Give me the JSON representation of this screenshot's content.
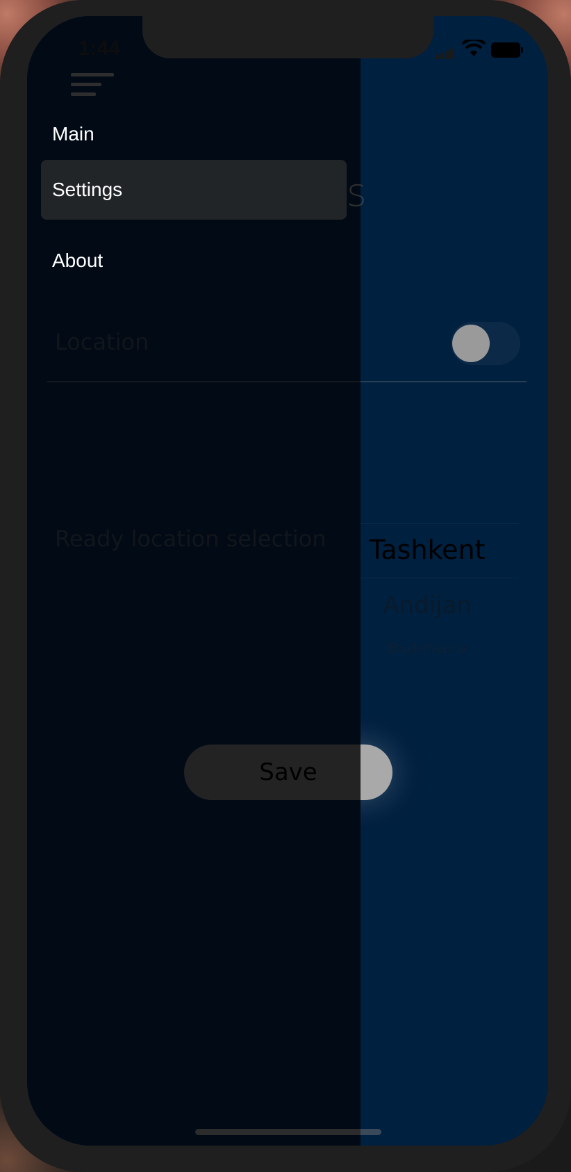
{
  "status_bar": {
    "time": "1:44"
  },
  "header": {
    "title": "Settings",
    "menu_icon": "hamburger-icon"
  },
  "settings": {
    "location_label": "Location",
    "location_toggle": "off",
    "ready_location_label": "Ready location selection",
    "picker": {
      "selected": "Tashkent",
      "options": [
        "Tashkent",
        "Andijan",
        "Bukhara"
      ]
    },
    "save_label": "Save"
  },
  "drawer": {
    "items": [
      {
        "label": "Main",
        "active": false
      },
      {
        "label": "Settings",
        "active": true
      },
      {
        "label": "About",
        "active": false
      }
    ]
  },
  "colors": {
    "background": "#002040",
    "drawer": "#010a14",
    "active_item": "#222528",
    "button": "#a9a9a9"
  }
}
